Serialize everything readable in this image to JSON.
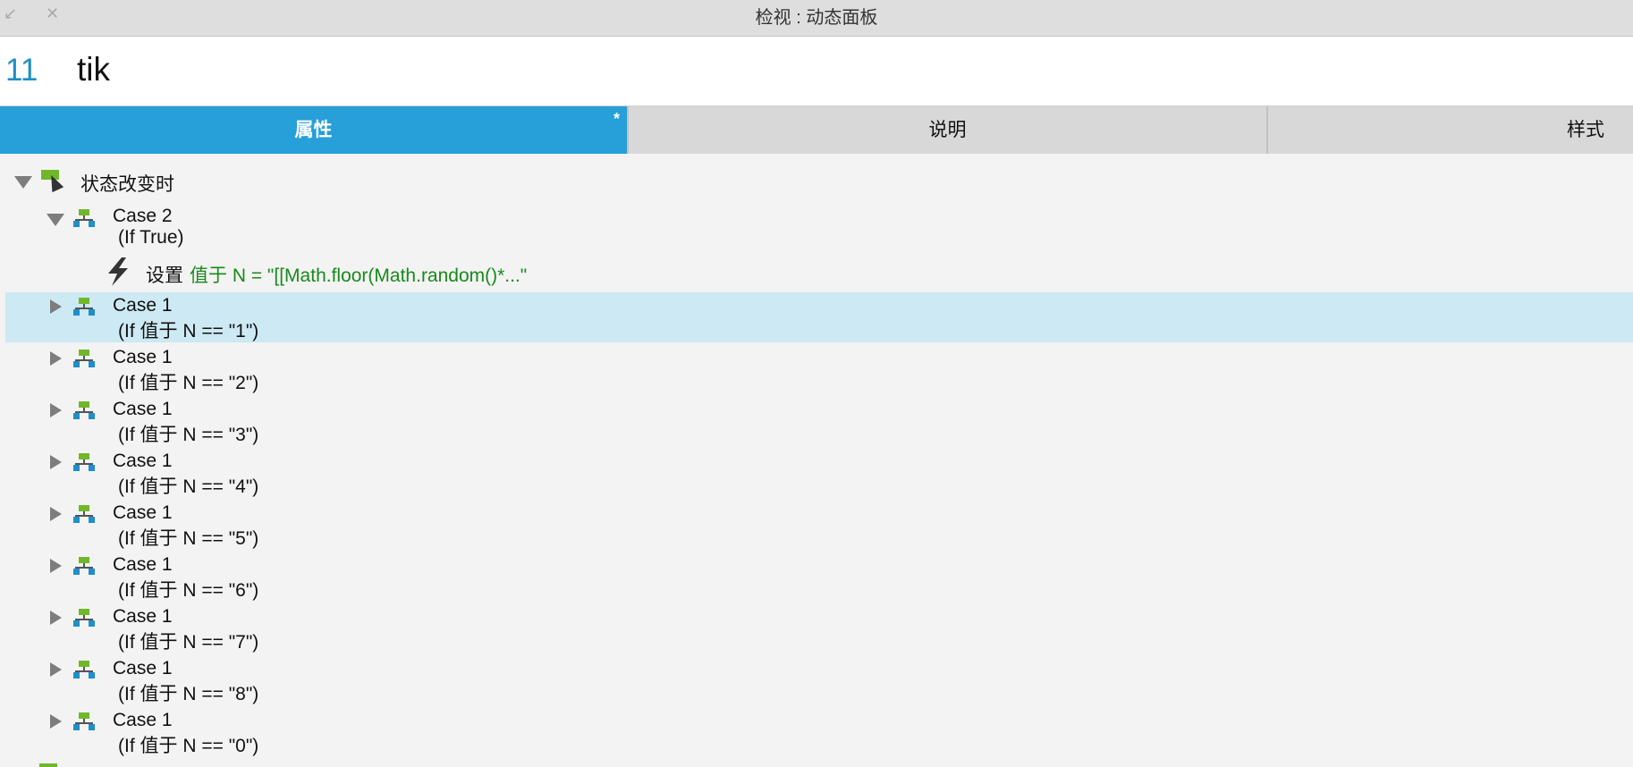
{
  "window": {
    "title": "检视 : 动态面板",
    "minimize_icon": "arrow-down-left-icon",
    "close_icon": "close-icon"
  },
  "widget": {
    "number": "11",
    "name": "tik"
  },
  "tabs": [
    {
      "label": "属性",
      "active": true,
      "modified_marker": "*"
    },
    {
      "label": "说明",
      "active": false
    },
    {
      "label": "样式",
      "active": false
    }
  ],
  "tree": {
    "event": {
      "label": "状态改变时",
      "expanded": true
    },
    "cases": [
      {
        "name": "Case 2",
        "condition": "(If True)",
        "expanded": true,
        "action": {
          "verb": "设置",
          "detail": "值于 N = \"[[Math.floor(Math.random()*...\""
        }
      },
      {
        "name": "Case 1",
        "condition": "(If 值于 N == \"1\")",
        "selected": true
      },
      {
        "name": "Case 1",
        "condition": "(If 值于 N == \"2\")"
      },
      {
        "name": "Case 1",
        "condition": "(If 值于 N == \"3\")"
      },
      {
        "name": "Case 1",
        "condition": "(If 值于 N == \"4\")"
      },
      {
        "name": "Case 1",
        "condition": "(If 值于 N == \"5\")"
      },
      {
        "name": "Case 1",
        "condition": "(If 值于 N == \"6\")"
      },
      {
        "name": "Case 1",
        "condition": "(If 值于 N == \"7\")"
      },
      {
        "name": "Case 1",
        "condition": "(If 值于 N == \"8\")"
      },
      {
        "name": "Case 1",
        "condition": "(If 值于 N == \"0\")"
      }
    ]
  },
  "colors": {
    "accent": "#279fd8",
    "selection": "#cde9f4",
    "action_text": "#178a1a",
    "widget_number": "#1e8fc9"
  }
}
